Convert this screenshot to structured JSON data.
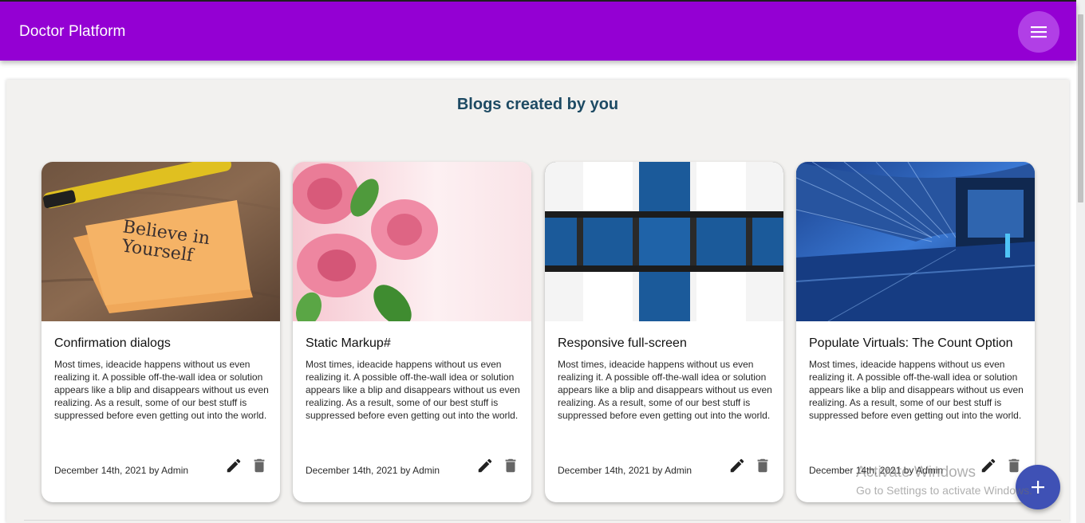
{
  "app": {
    "title": "Doctor Platform",
    "accent_color": "#9400d3",
    "menu_icon": "menu-icon"
  },
  "section": {
    "title": "Blogs created by you"
  },
  "cards": [
    {
      "title": "Confirmation dialogs",
      "text": "Most times, ideacide happens without us even realizing it. A possible off-the-wall idea or solution appears like a blip and disappears without us even realizing. As a result, some of our best stuff is suppressed before even getting out into the world.",
      "meta": "December 14th, 2021 by Admin",
      "image": "believe-in-yourself-note",
      "image_text": "Believe in Yourself"
    },
    {
      "title": "Static Markup#",
      "text": "Most times, ideacide happens without us even realizing it. A possible off-the-wall idea or solution appears like a blip and disappears without us even realizing. As a result, some of our best stuff is suppressed before even getting out into the world.",
      "meta": "December 14th, 2021 by Admin",
      "image": "pink-roses"
    },
    {
      "title": "Responsive full-screen",
      "text": "Most times, ideacide happens without us even realizing it. A possible off-the-wall idea or solution appears like a blip and disappears without us even realizing. As a result, some of our best stuff is suppressed before even getting out into the world.",
      "meta": "December 14th, 2021 by Admin",
      "image": "blue-white-cubes"
    },
    {
      "title": "Populate Virtuals: The Count Option",
      "text": "Most times, ideacide happens without us even realizing it. A possible off-the-wall idea or solution appears like a blip and disappears without us even realizing. As a result, some of our best stuff is suppressed before even getting out into the world.",
      "meta": "December 14th, 2021 by Admin",
      "image": "blue-architecture-tunnel"
    }
  ],
  "card_actions": {
    "edit_icon": "edit-icon",
    "delete_icon": "delete-icon"
  },
  "fab": {
    "icon": "add-icon",
    "color": "#3f51b5"
  },
  "watermark": {
    "title": "Activate Windows",
    "subtitle": "Go to Settings to activate Windows."
  }
}
